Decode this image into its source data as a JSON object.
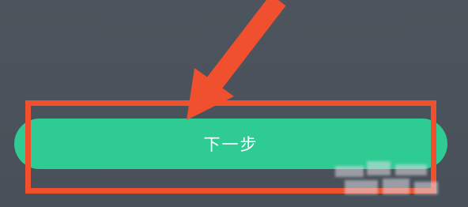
{
  "next_button": {
    "label": "下一步"
  },
  "colors": {
    "background": "#4b525b",
    "button": "#2ecc93",
    "button_text": "#ffffff",
    "annotation": "#f0502e"
  },
  "icons": {
    "pointer": "arrow-icon"
  }
}
